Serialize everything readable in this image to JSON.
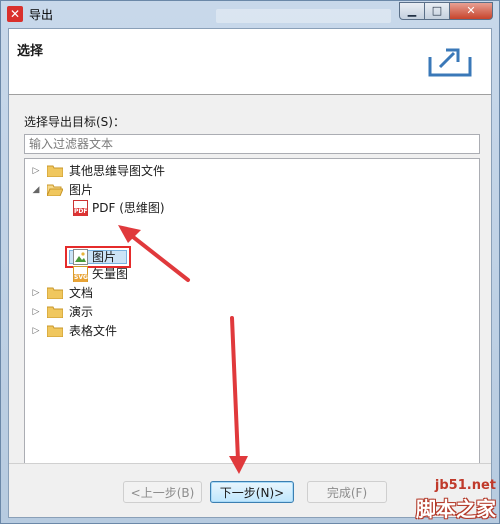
{
  "window": {
    "title": "导出",
    "app_icon": "x-logo-icon",
    "min": "▁",
    "max": "□",
    "close": "✕"
  },
  "banner": {
    "title": "选择"
  },
  "target_label": "选择导出目标(S)：",
  "filter": {
    "placeholder": "输入过滤器文本",
    "value": ""
  },
  "tree": {
    "items": [
      {
        "label": "其他思维导图文件",
        "expanded": false
      },
      {
        "label": "图片",
        "expanded": true
      },
      {
        "label": "PDF (思维图)",
        "icon": "PDF"
      },
      {
        "label": "图片",
        "selected": true
      },
      {
        "label": "矢量图",
        "icon": "SVG"
      },
      {
        "label": "文档",
        "expanded": false
      },
      {
        "label": "演示",
        "expanded": false
      },
      {
        "label": "表格文件",
        "expanded": false
      }
    ]
  },
  "buttons": {
    "back": "<上一步(B)",
    "next": "下一步(N)>",
    "finish": "完成(F)"
  },
  "watermark": {
    "url": "jb51.net",
    "text": "脚本之家"
  },
  "colors": {
    "selection_box": "#e52b2b",
    "arrow": "#e0393c",
    "folder": "#f0c75e"
  }
}
